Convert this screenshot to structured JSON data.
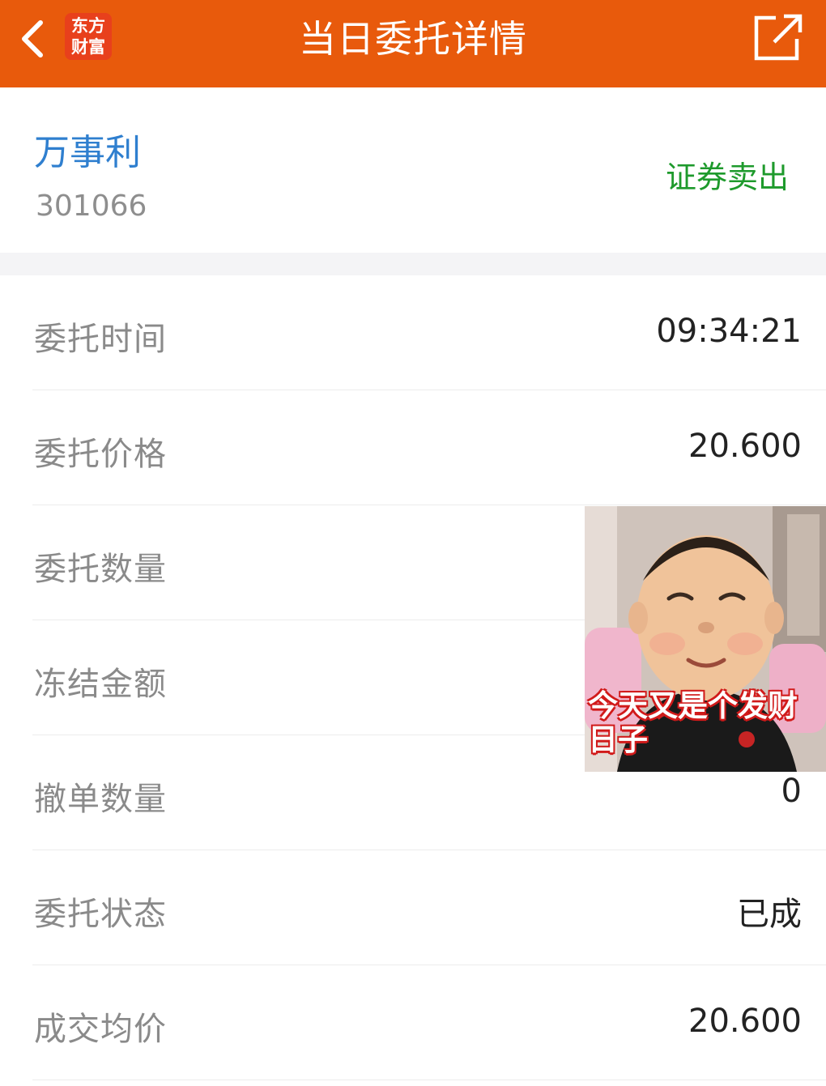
{
  "header": {
    "title": "当日委托详情",
    "logo_line1": "东方",
    "logo_line2": "财富",
    "back_icon": "chevron-left-icon",
    "share_icon": "share-external-icon",
    "background_color": "#e85a0c"
  },
  "stock": {
    "name": "万事利",
    "code": "301066",
    "action": "证券卖出",
    "name_color": "#2f7fcf",
    "action_color": "#1e9a2c"
  },
  "details": [
    {
      "label": "委托时间",
      "value": "09:34:21"
    },
    {
      "label": "委托价格",
      "value": "20.600"
    },
    {
      "label": "委托数量",
      "value": ""
    },
    {
      "label": "冻结金额",
      "value": ""
    },
    {
      "label": "撤单数量",
      "value": "0"
    },
    {
      "label": "委托状态",
      "value": "已成"
    },
    {
      "label": "成交均价",
      "value": "20.600"
    }
  ],
  "sticker": {
    "caption_line1": "今天又是个发财",
    "caption_line2": "日子"
  }
}
